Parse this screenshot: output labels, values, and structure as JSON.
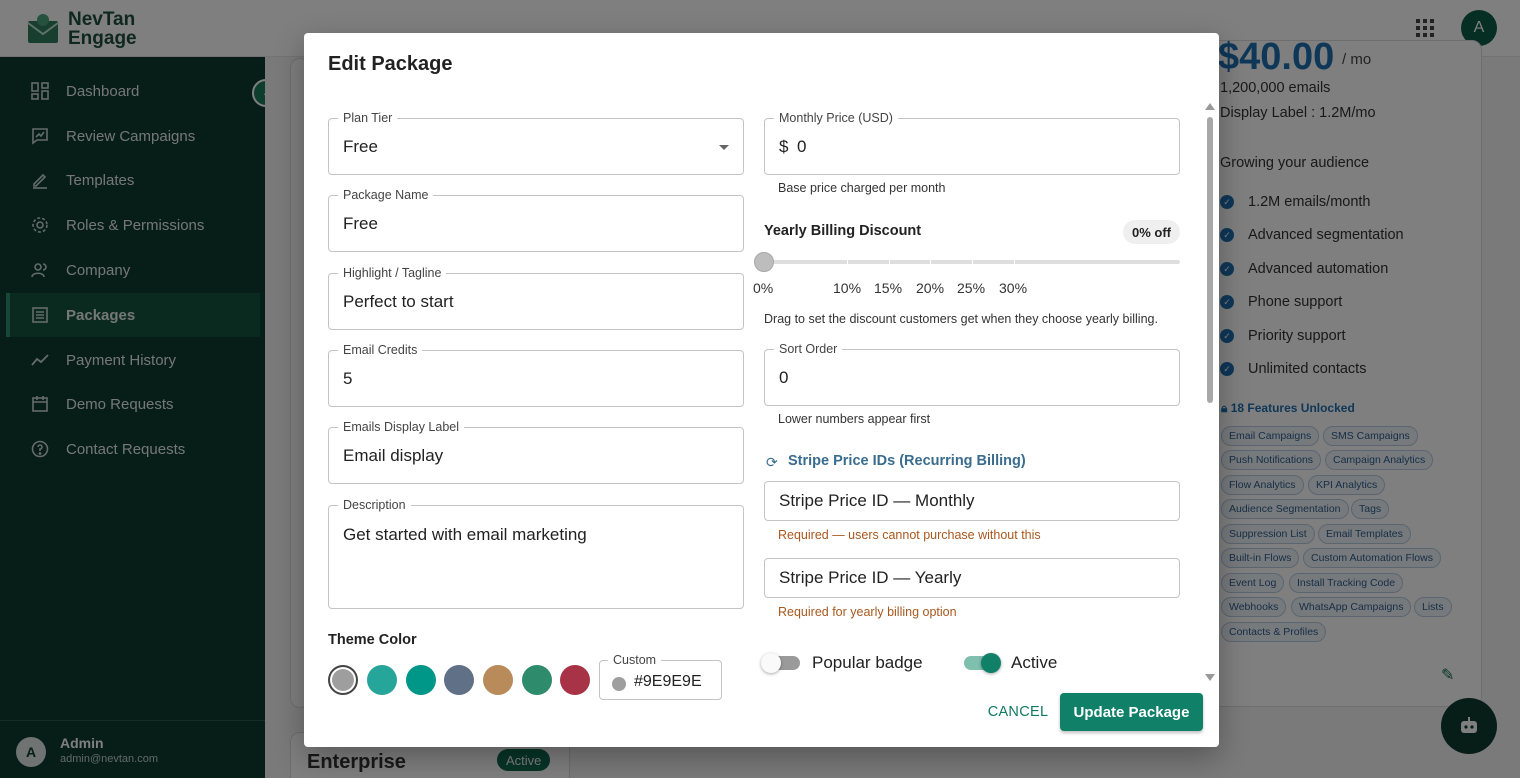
{
  "app": {
    "name_line1": "NevTan",
    "name_line2": "Engage",
    "avatar_initial": "A"
  },
  "sidebar": {
    "items": [
      {
        "label": "Dashboard",
        "icon": "dashboard-icon"
      },
      {
        "label": "Review Campaigns",
        "icon": "review-icon"
      },
      {
        "label": "Templates",
        "icon": "pen-icon"
      },
      {
        "label": "Roles & Permissions",
        "icon": "gear-icon"
      },
      {
        "label": "Company",
        "icon": "people-icon"
      },
      {
        "label": "Packages",
        "icon": "list-icon",
        "active": true
      },
      {
        "label": "Payment History",
        "icon": "trend-icon"
      },
      {
        "label": "Demo Requests",
        "icon": "calendar-icon"
      },
      {
        "label": "Contact Requests",
        "icon": "help-icon"
      }
    ],
    "user": {
      "initial": "A",
      "name": "Admin",
      "email": "admin@nevtan.com"
    }
  },
  "background": {
    "price": "$40.00",
    "price_suffix": "/ mo",
    "emails": "1,200,000 emails",
    "display_label": "Display Label : 1.2M/mo",
    "tagline": "Growing your audience",
    "features": [
      "1.2M emails/month",
      "Advanced segmentation",
      "Advanced automation",
      "Phone support",
      "Priority support",
      "Unlimited contacts"
    ],
    "unlocked": "18 Features Unlocked",
    "chips": [
      "Email Campaigns",
      "SMS Campaigns",
      "Push Notifications",
      "Campaign Analytics",
      "Flow Analytics",
      "KPI Analytics",
      "Audience Segmentation",
      "Tags",
      "Suppression List",
      "Email Templates",
      "Built-in Flows",
      "Custom Automation Flows",
      "Event Log",
      "Install Tracking Code",
      "Webhooks",
      "WhatsApp Campaigns",
      "Lists",
      "Contacts & Profiles"
    ],
    "enterprise_title": "Enterprise",
    "enterprise_status": "Active"
  },
  "modal": {
    "title": "Edit Package",
    "plan_tier": {
      "label": "Plan Tier",
      "value": "Free"
    },
    "package_name": {
      "label": "Package Name",
      "value": "Free"
    },
    "tagline": {
      "label": "Highlight / Tagline",
      "value": "Perfect to start"
    },
    "email_credits": {
      "label": "Email Credits",
      "value": "5"
    },
    "emails_display_label": {
      "label": "Emails Display Label",
      "value": "Email display"
    },
    "description": {
      "label": "Description",
      "value": "Get started with email marketing"
    },
    "theme_color": {
      "title": "Theme Color",
      "swatches": [
        "#9e9e9e",
        "#26a69a",
        "#009688",
        "#607086",
        "#b98a5a",
        "#2e8b6b",
        "#a83246"
      ],
      "selected": "#9e9e9e",
      "custom_label": "Custom",
      "custom_value": "#9E9E9E"
    },
    "monthly_price": {
      "label": "Monthly Price (USD)",
      "currency": "$",
      "value": "0",
      "helper": "Base price charged per month"
    },
    "yearly_discount": {
      "title": "Yearly Billing Discount",
      "badge": "0% off",
      "value_percent": 0,
      "marks": [
        "0%",
        "10%",
        "15%",
        "20%",
        "25%",
        "30%"
      ],
      "helper": "Drag to set the discount customers get when they choose yearly billing."
    },
    "sort_order": {
      "label": "Sort Order",
      "value": "0",
      "helper": "Lower numbers appear first"
    },
    "stripe": {
      "title": "Stripe Price IDs (Recurring Billing)",
      "monthly_placeholder": "Stripe Price ID — Monthly",
      "monthly_helper": "Required — users cannot purchase without this",
      "yearly_placeholder": "Stripe Price ID — Yearly",
      "yearly_helper": "Required for yearly billing option"
    },
    "toggles": {
      "popular": {
        "label": "Popular badge",
        "on": false
      },
      "active": {
        "label": "Active",
        "on": true
      }
    },
    "cancel_label": "CANCEL",
    "submit_label": "Update Package"
  },
  "colors": {
    "accent": "#118068",
    "sidebar": "#0f3b2e",
    "link_blue": "#1e6fb0",
    "warn": "#a8581f"
  }
}
